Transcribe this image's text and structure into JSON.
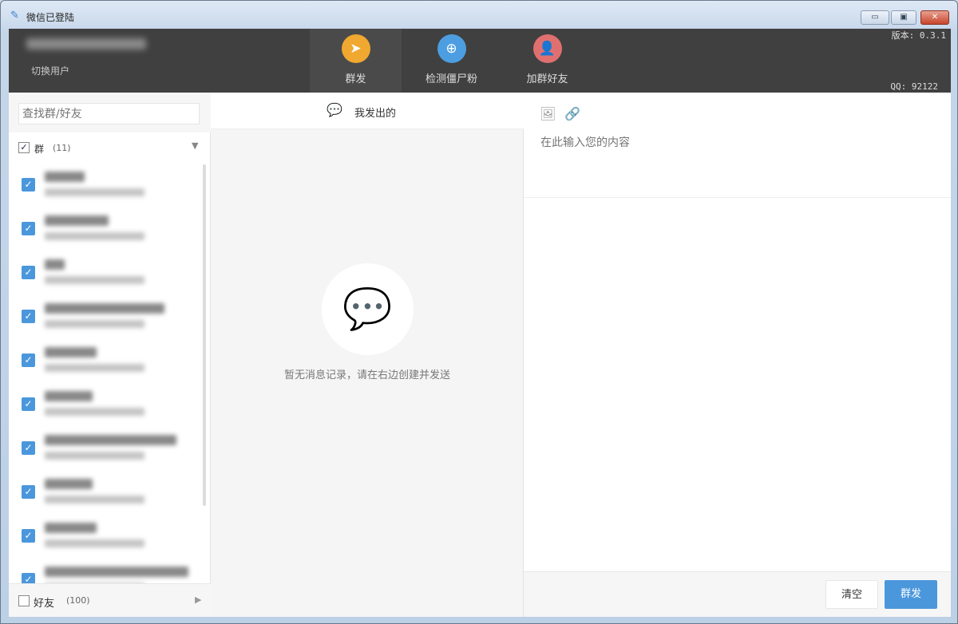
{
  "window": {
    "title": "微信已登陆",
    "icon": "wrench-icon"
  },
  "header": {
    "switch_user": "切换用户",
    "version": "版本: 0.3.1",
    "qq": "QQ: 92122",
    "tools": [
      {
        "label": "群发",
        "icon": "paper-plane-icon",
        "color": "#f0a830"
      },
      {
        "label": "检测僵尸粉",
        "icon": "search-user-icon",
        "color": "#4d9ee0"
      },
      {
        "label": "加群好友",
        "icon": "add-user-icon",
        "color": "#e07070"
      }
    ]
  },
  "left": {
    "search_placeholder": "查找群/好友",
    "group_label": "群",
    "group_count": "(11)",
    "friend_label": "好友",
    "friend_count": "(100)",
    "group_items_visible": 10
  },
  "middle": {
    "header": "我发出的",
    "empty_text": "暂无消息记录，请在右边创建并发送"
  },
  "right": {
    "placeholder": "在此输入您的内容",
    "clear_label": "清空",
    "send_label": "群发"
  }
}
